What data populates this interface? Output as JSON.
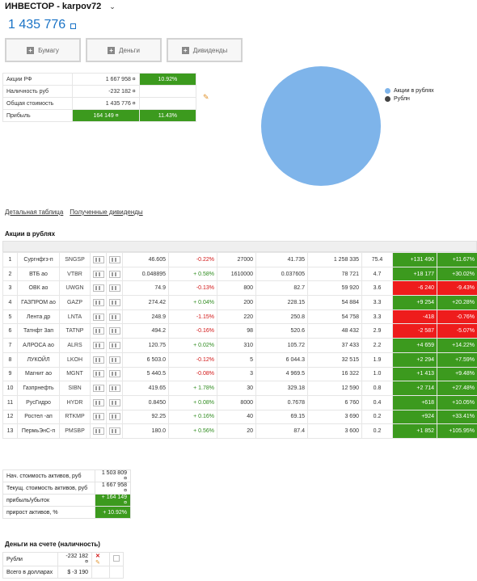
{
  "header": {
    "title": "ИНВЕСТОР - karpov72",
    "chevron": "⌄"
  },
  "total": {
    "value": "1 435 776"
  },
  "actions": [
    {
      "label": "Бумагу"
    },
    {
      "label": "Деньги"
    },
    {
      "label": "Дивиденды"
    }
  ],
  "summary": {
    "rows": [
      {
        "label": "Акции РФ",
        "value": "1 667 958 ¤",
        "extra": "10.92%"
      },
      {
        "label": "Наличность руб",
        "value": "-232 182 ¤",
        "extra": ""
      },
      {
        "label": "Общая стоимость",
        "value": "1 435 776 ¤",
        "extra": ""
      },
      {
        "label": "Прибыль",
        "value": "164 149 ¤",
        "extra": "11.43%"
      }
    ]
  },
  "legend": {
    "items": [
      {
        "label": "Акции в рублях",
        "color": "#7eb4ea"
      },
      {
        "label": "Рублн",
        "color": "#444444"
      }
    ]
  },
  "chart_data": {
    "type": "pie",
    "slices": [
      {
        "name": "Акции в рублях",
        "value": 100
      },
      {
        "name": "Рублн",
        "value": 0
      }
    ]
  },
  "links": [
    "Детальная таблица",
    "Полученные дивиденды"
  ],
  "stocks": {
    "title": "Акции в рублях",
    "rows": [
      {
        "idx": "1",
        "name": "Сургнфгз-п",
        "ticker": "SNGSP",
        "price": "46.605",
        "chg": "-0.22%",
        "dir": "dn",
        "qty": "27000",
        "avg": "41.735",
        "value": "1 258 335",
        "pct": "75.4",
        "pl": "+131 490",
        "plp": "+11.67%",
        "plsign": "pos"
      },
      {
        "idx": "2",
        "name": "ВТБ ао",
        "ticker": "VTBR",
        "price": "0.048895",
        "chg": "+ 0.58%",
        "dir": "up",
        "qty": "1610000",
        "avg": "0.037605",
        "value": "78 721",
        "pct": "4.7",
        "pl": "+18 177",
        "plp": "+30.02%",
        "plsign": "pos"
      },
      {
        "idx": "3",
        "name": "ОВК ао",
        "ticker": "UWGN",
        "price": "74.9",
        "chg": "-0.13%",
        "dir": "dn",
        "qty": "800",
        "avg": "82.7",
        "value": "59 920",
        "pct": "3.6",
        "pl": "-6 240",
        "plp": "-9.43%",
        "plsign": "neg"
      },
      {
        "idx": "4",
        "name": "ГАЗПРОМ ао",
        "ticker": "GAZP",
        "price": "274.42",
        "chg": "+ 0.04%",
        "dir": "up",
        "qty": "200",
        "avg": "228.15",
        "value": "54 884",
        "pct": "3.3",
        "pl": "+9 254",
        "plp": "+20.28%",
        "plsign": "pos"
      },
      {
        "idx": "5",
        "name": "Лента др",
        "ticker": "LNTA",
        "price": "248.9",
        "chg": "-1.15%",
        "dir": "dn",
        "qty": "220",
        "avg": "250.8",
        "value": "54 758",
        "pct": "3.3",
        "pl": "-418",
        "plp": "-0.76%",
        "plsign": "neg"
      },
      {
        "idx": "6",
        "name": "Татнфт 3ап",
        "ticker": "TATNP",
        "price": "494.2",
        "chg": "-0.16%",
        "dir": "dn",
        "qty": "98",
        "avg": "520.6",
        "value": "48 432",
        "pct": "2.9",
        "pl": "-2 587",
        "plp": "-5.07%",
        "plsign": "neg"
      },
      {
        "idx": "7",
        "name": "АЛРОСА ао",
        "ticker": "ALRS",
        "price": "120.75",
        "chg": "+ 0.02%",
        "dir": "up",
        "qty": "310",
        "avg": "105.72",
        "value": "37 433",
        "pct": "2.2",
        "pl": "+4 659",
        "plp": "+14.22%",
        "plsign": "pos"
      },
      {
        "idx": "8",
        "name": "ЛУКОЙЛ",
        "ticker": "LKOH",
        "price": "6 503.0",
        "chg": "-0.12%",
        "dir": "dn",
        "qty": "5",
        "avg": "6 044.3",
        "value": "32 515",
        "pct": "1.9",
        "pl": "+2 294",
        "plp": "+7.59%",
        "plsign": "pos"
      },
      {
        "idx": "9",
        "name": "Магнит ао",
        "ticker": "MGNT",
        "price": "5 440.5",
        "chg": "-0.08%",
        "dir": "dn",
        "qty": "3",
        "avg": "4 969.5",
        "value": "16 322",
        "pct": "1.0",
        "pl": "+1 413",
        "plp": "+9.48%",
        "plsign": "pos"
      },
      {
        "idx": "10",
        "name": "Газпрнефть",
        "ticker": "SIBN",
        "price": "419.65",
        "chg": "+ 1.78%",
        "dir": "up",
        "qty": "30",
        "avg": "329.18",
        "value": "12 590",
        "pct": "0.8",
        "pl": "+2 714",
        "plp": "+27.48%",
        "plsign": "pos"
      },
      {
        "idx": "11",
        "name": "РусГидро",
        "ticker": "HYDR",
        "price": "0.8450",
        "chg": "+ 0.08%",
        "dir": "up",
        "qty": "8000",
        "avg": "0.7678",
        "value": "6 760",
        "pct": "0.4",
        "pl": "+618",
        "plp": "+10.05%",
        "plsign": "pos"
      },
      {
        "idx": "12",
        "name": "Ростел -ап",
        "ticker": "RTKMP",
        "price": "92.25",
        "chg": "+ 0.16%",
        "dir": "up",
        "qty": "40",
        "avg": "69.15",
        "value": "3 690",
        "pct": "0.2",
        "pl": "+924",
        "plp": "+33.41%",
        "plsign": "pos"
      },
      {
        "idx": "13",
        "name": "ПермьЭнС-п",
        "ticker": "PMSBP",
        "price": "180.0",
        "chg": "+ 0.56%",
        "dir": "up",
        "qty": "20",
        "avg": "87.4",
        "value": "3 600",
        "pct": "0.2",
        "pl": "+1 852",
        "plp": "+105.95%",
        "plsign": "pos"
      }
    ]
  },
  "totals": {
    "rows": [
      {
        "label": "Нач. стоимость активов, руб",
        "value": "1 503 809 ¤",
        "green": false
      },
      {
        "label": "Текущ. стоимость активов, руб",
        "value": "1 667 958 ¤",
        "green": false
      },
      {
        "label": "прибыль/убыток",
        "value": "+ 164 149 ¤",
        "green": true
      },
      {
        "label": "прирост активов, %",
        "value": "+ 10.92%",
        "green": true
      }
    ]
  },
  "cash": {
    "title": "Деньги на счете (наличность)",
    "rows": [
      {
        "label": "Рубли",
        "value": "-232 182 ¤"
      },
      {
        "label": "Всего в долларах",
        "value": "$ -3 190"
      }
    ]
  }
}
